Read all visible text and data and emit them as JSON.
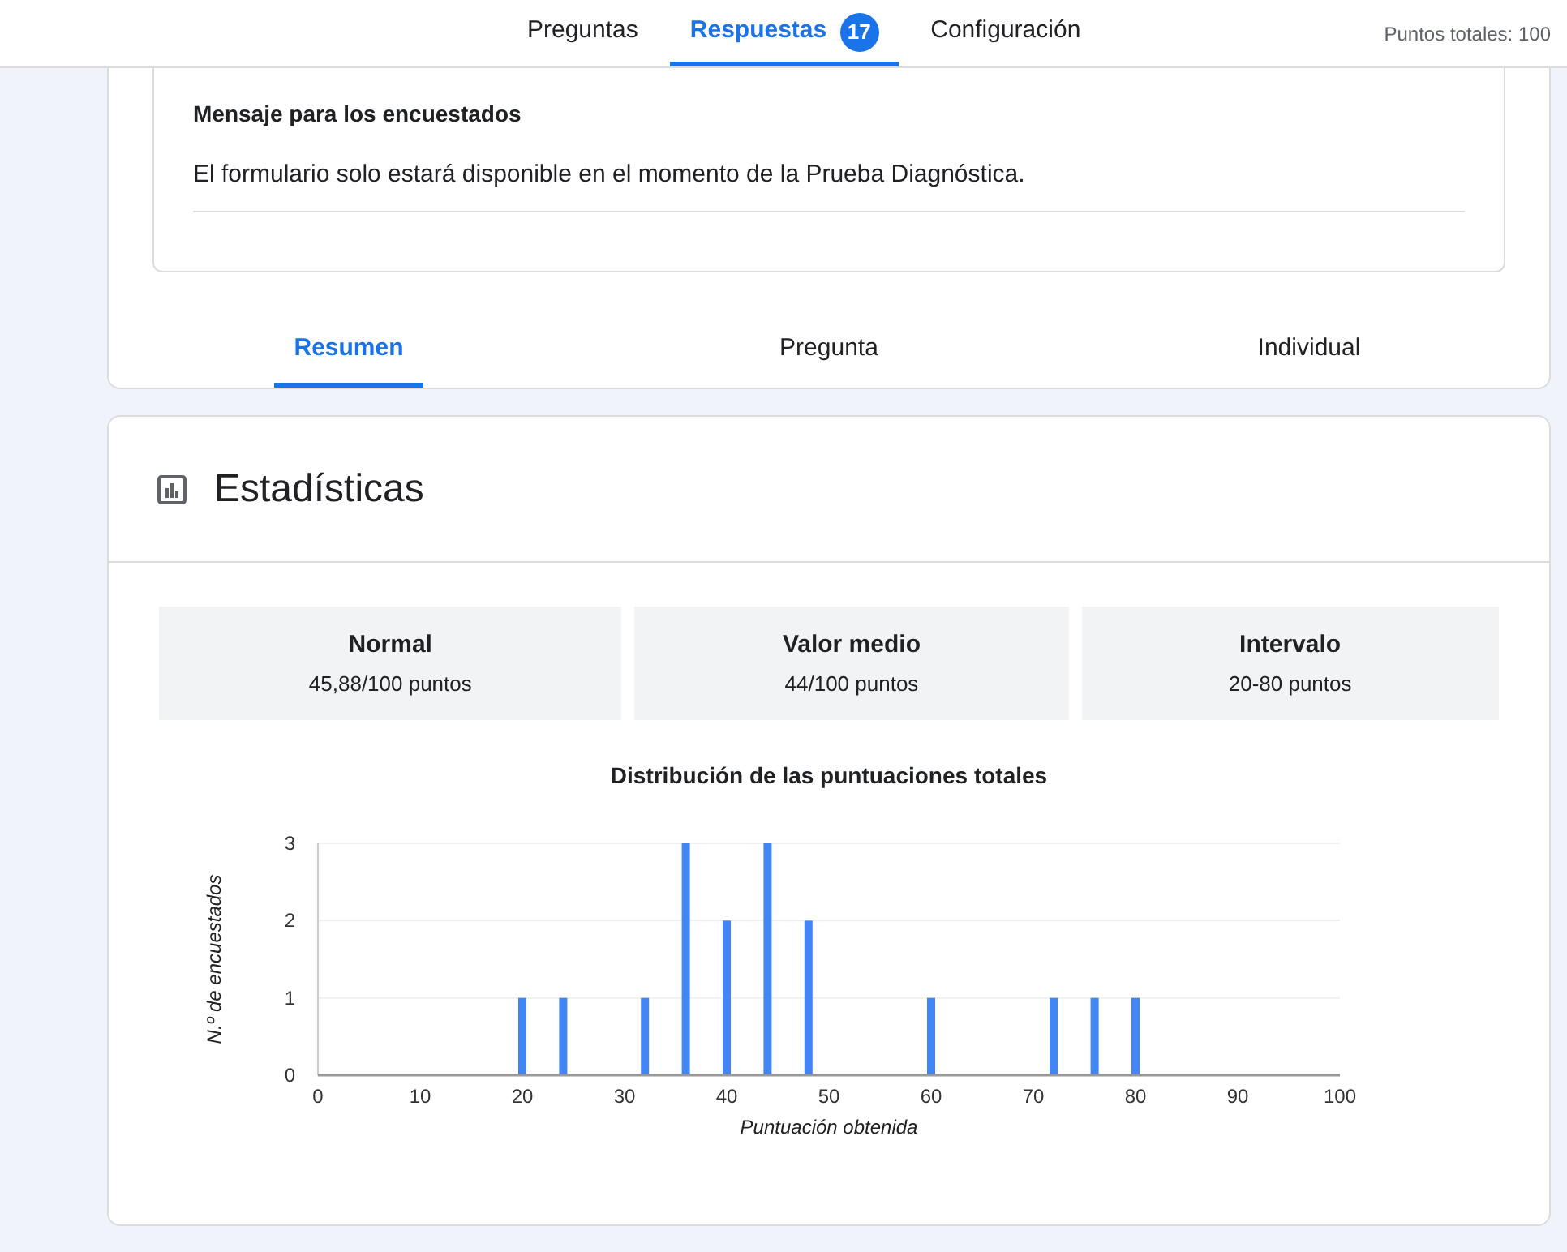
{
  "top_tabs": [
    {
      "label": "Preguntas",
      "selected": false
    },
    {
      "label": "Respuestas",
      "selected": true,
      "badge": "17"
    },
    {
      "label": "Configuración",
      "selected": false
    }
  ],
  "total_points": "Puntos totales: 100",
  "message": {
    "title": "Mensaje para los encuestados",
    "text": "El formulario solo estará disponible en el momento de la Prueba Diagnóstica."
  },
  "view_tabs": [
    {
      "label": "Resumen",
      "selected": true
    },
    {
      "label": "Pregunta",
      "selected": false
    },
    {
      "label": "Individual",
      "selected": false
    }
  ],
  "stats": {
    "title": "Estadísticas",
    "cards": [
      {
        "label": "Normal",
        "value": "45,88/100 puntos"
      },
      {
        "label": "Valor medio",
        "value": "44/100 puntos"
      },
      {
        "label": "Intervalo",
        "value": "20-80 puntos"
      }
    ],
    "chart_data": {
      "type": "bar",
      "title": "Distribución de las puntuaciones totales",
      "xlabel": "Puntuación obtenida",
      "ylabel": "N.º de encuestados",
      "x": [
        20,
        24,
        32,
        36,
        40,
        44,
        48,
        60,
        72,
        76,
        80
      ],
      "series": [
        {
          "color": "#4285f4",
          "values": [
            1,
            1,
            1,
            3,
            2,
            3,
            2,
            1,
            1,
            1,
            1
          ]
        }
      ],
      "xlim": [
        0,
        100
      ],
      "ylim": [
        0,
        3
      ],
      "xticks": [
        0,
        10,
        20,
        30,
        40,
        50,
        60,
        70,
        80,
        90,
        100
      ],
      "yticks": [
        0,
        1,
        2,
        3
      ]
    }
  }
}
